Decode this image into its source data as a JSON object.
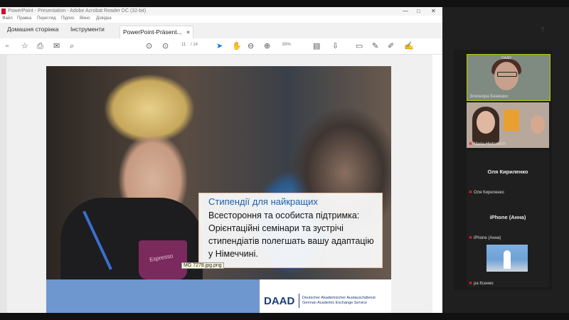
{
  "window": {
    "title": "PowerPoint - Presentation - Adobe Acrobat Reader DC (32-bit)",
    "menu": [
      "Файл",
      "Правка",
      "Перегляд",
      "Підпис",
      "Вікно",
      "Довідка"
    ]
  },
  "tabs": [
    {
      "label": "Домашня сторінка"
    },
    {
      "label": "Інструменти"
    },
    {
      "label": "PowerPoint-Präsent...",
      "close": "×"
    }
  ],
  "toolbar": {
    "page_current": "11",
    "page_total": "/ 14",
    "zoom": "89%"
  },
  "slide": {
    "title": "Стипендії для найкращих",
    "body": "Всестороння та особиста підтримка: Орієнтаційні семінари та зустрічі стипендіатів полегшать вашу адаптацію у Німеччині.",
    "tooltip": "MG 7278.jpg.png",
    "cup_text": "Espresso",
    "logo": "DAAD",
    "logo_sub_1": "Deutscher Akademischer Austauschdienst",
    "logo_sub_2": "German Academic Exchange Service"
  },
  "participants": [
    {
      "name": "Элеонора Бенешко",
      "watermark": "DAAD",
      "video": true,
      "muted": false
    },
    {
      "name": "Maria Hrytsevich",
      "video": true,
      "muted": true
    },
    {
      "name": "Оля Кириленко",
      "video": false,
      "muted": true
    },
    {
      "name": "iPhone (Анна)",
      "video": false,
      "muted": true
    },
    {
      "name": "ра Ксенко",
      "video": true,
      "muted": true
    }
  ],
  "colors": {
    "accent_blue": "#1473e6",
    "slide_title": "#1f5fa8",
    "active_speaker": "#b5d000",
    "daad_blue": "#1a3f78"
  }
}
